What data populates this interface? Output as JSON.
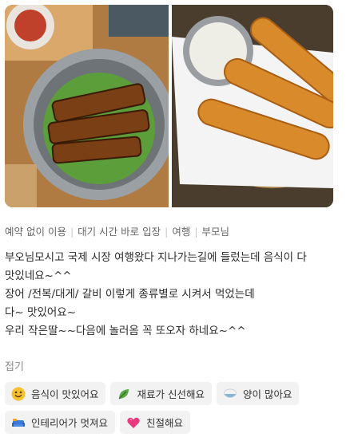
{
  "tags": [
    "예약 없이 이용",
    "대기 시간 바로 입장",
    "여행",
    "부모님"
  ],
  "review": {
    "lines": [
      "부오님모시고 국제 시장 여행왔다 지나가는길에 들렀는데 음식이 다",
      "맛있네요~^^",
      "장어 /전복/대게/ 갈비 이렇게 종류별로 시켜서 먹었는데",
      "다~ 맛있어요~",
      "우리 작은딸~~다음에 놀러옴 꼭 또오자 하네요~^^"
    ]
  },
  "fold_label": "접기",
  "keywords": [
    {
      "icon": "smiley-icon",
      "label": "음식이 맛있어요"
    },
    {
      "icon": "leaf-icon",
      "label": "재료가 신선해요"
    },
    {
      "icon": "rice-bowl-icon",
      "label": "양이 많아요"
    },
    {
      "icon": "sofa-icon",
      "label": "인테리어가 멋져요"
    },
    {
      "icon": "heart-icon",
      "label": "친절해요"
    }
  ]
}
